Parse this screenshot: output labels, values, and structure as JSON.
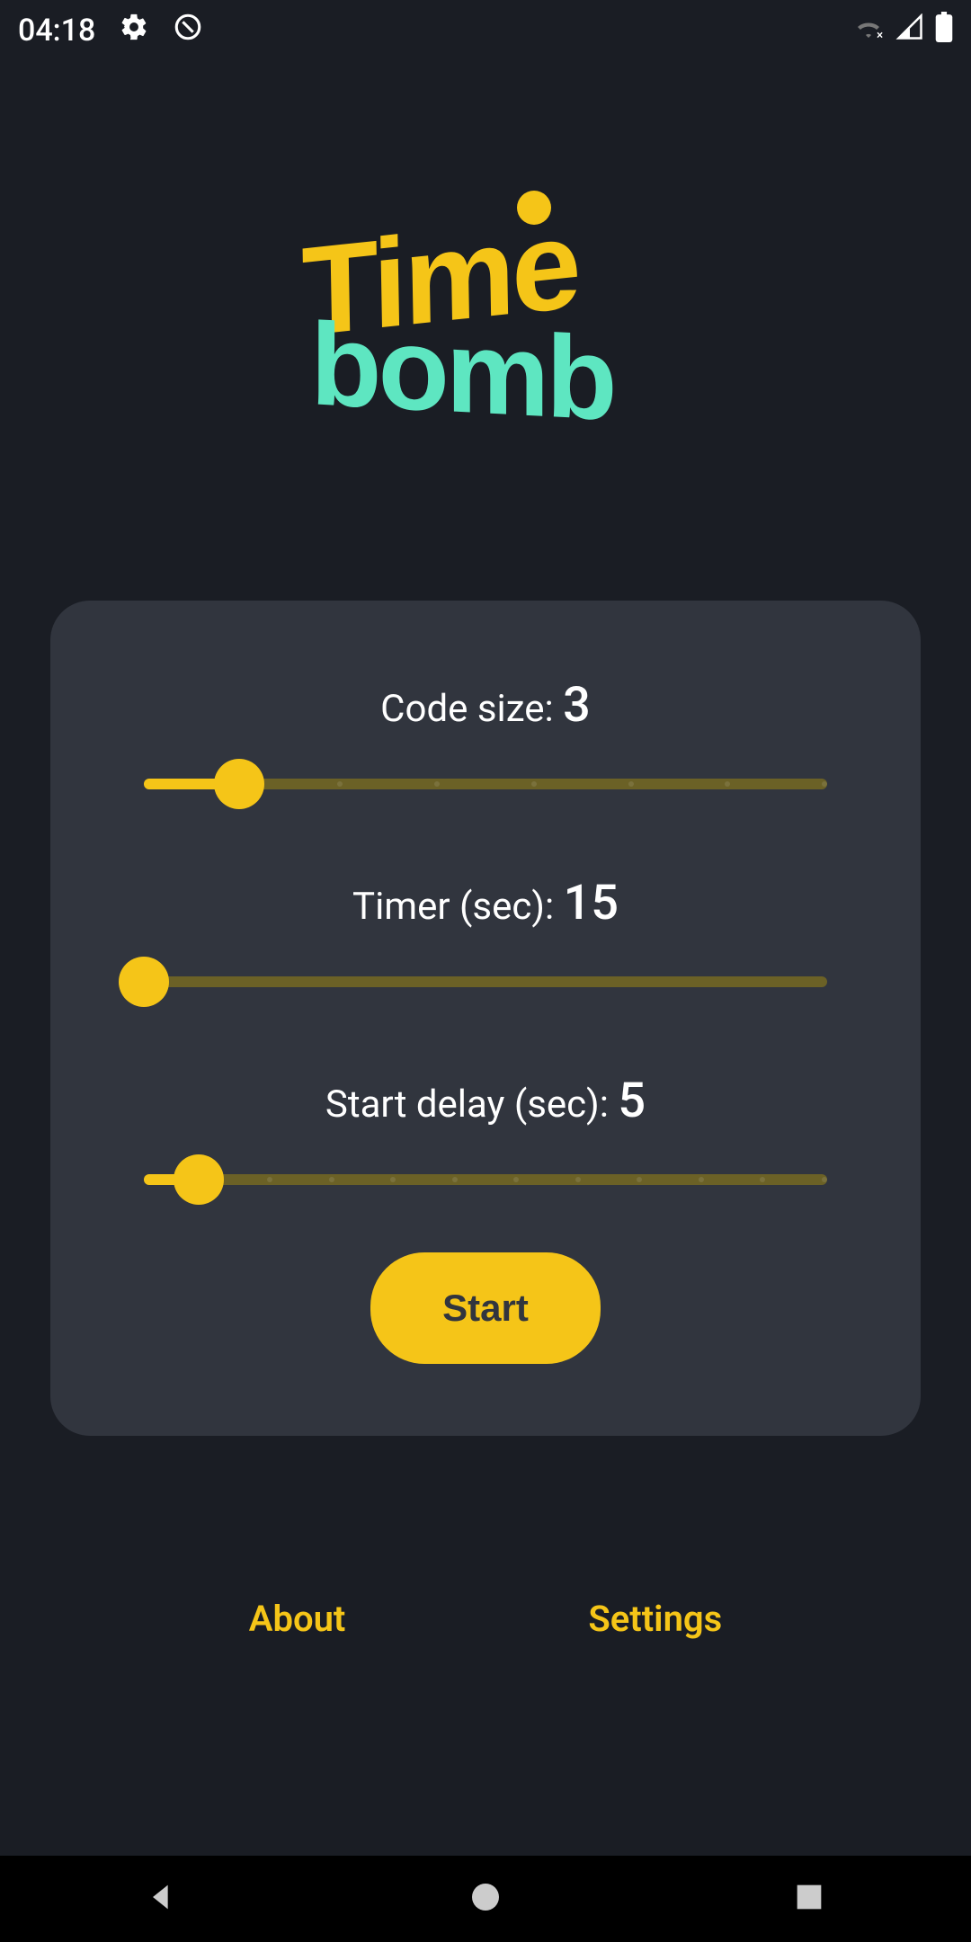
{
  "statusbar": {
    "time": "04:18"
  },
  "logo": {
    "line1": "Time",
    "line2": "bomb"
  },
  "settings": {
    "code_size": {
      "label": "Code size: ",
      "value": "3",
      "min": 2,
      "max": 9,
      "percent": 14
    },
    "timer": {
      "label": "Timer (sec): ",
      "value": "15",
      "min": 15,
      "max": 300,
      "percent": 0
    },
    "delay": {
      "label": "Start delay (sec): ",
      "value": "5",
      "min": 4,
      "max": 15,
      "percent": 8
    }
  },
  "buttons": {
    "start": "Start",
    "about": "About",
    "settings": "Settings"
  }
}
